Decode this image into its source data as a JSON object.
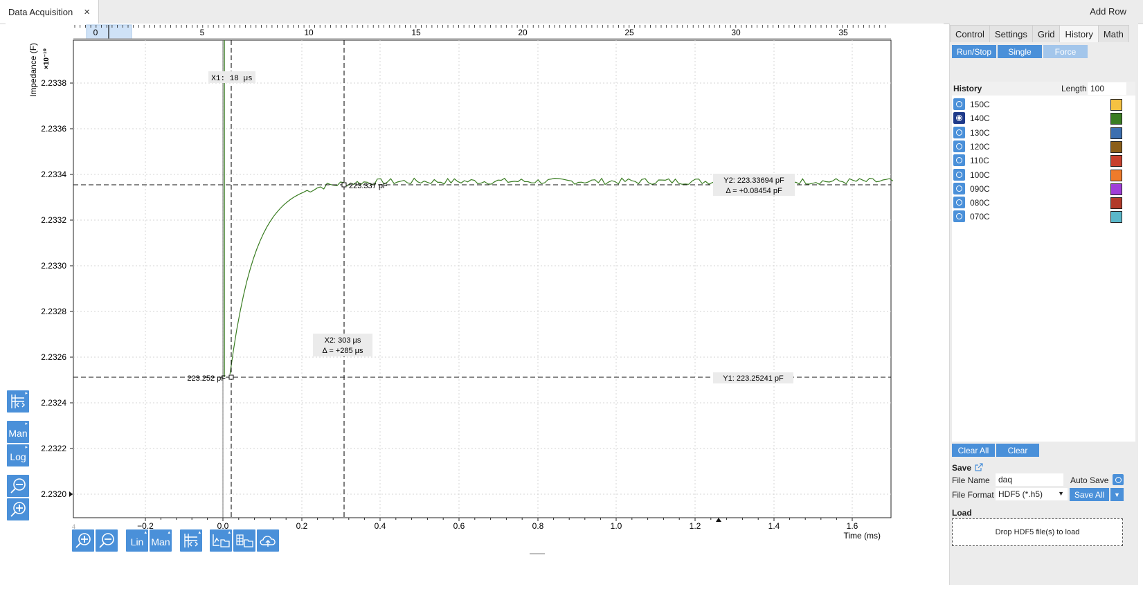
{
  "tab": {
    "title": "Data Acquisition",
    "close": "×"
  },
  "header": {
    "add_row": "Add Row"
  },
  "plot": {
    "y_axis_label": "Impedance (F)",
    "y_exponent": "×10⁻¹⁰",
    "x_axis_label": "Time (ms)",
    "y_ticks": [
      "2.2320",
      "2.2322",
      "2.2324",
      "2.2326",
      "2.2328",
      "2.2330",
      "2.2332",
      "2.2334",
      "2.2336",
      "2.2338"
    ],
    "x_ticks": [
      "−0.2",
      "0.0",
      "0.2",
      "0.4",
      "0.6",
      "0.8",
      "1.0",
      "1.2",
      "1.4",
      "1.6"
    ],
    "top_ticks": [
      "0",
      "5",
      "10",
      "15",
      "20",
      "25",
      "30",
      "35"
    ],
    "cursor_x1": {
      "label": "X1: 18 µs"
    },
    "cursor_x2": {
      "label": "X2: 303 µs",
      "delta": "Δ = +285 µs"
    },
    "cursor_y1": {
      "label": "Y1: 223.25241 pF"
    },
    "cursor_y2": {
      "label": "Y2: 223.33694 pF",
      "delta": "Δ = +0.08454 pF"
    },
    "point_low": "223.252 pF",
    "point_high": "223.337 pF",
    "trace_color": "#3a7d22"
  },
  "left_toolbar": {
    "man": "Man",
    "log": "Log"
  },
  "bottom_toolbar": {
    "lin": "Lin",
    "man": "Man"
  },
  "panel": {
    "tabs": [
      "Control",
      "Settings",
      "Grid",
      "History",
      "Math"
    ],
    "active_tab": "History",
    "buttons": {
      "run_stop": "Run/Stop",
      "single": "Single",
      "force": "Force"
    },
    "history": {
      "title": "History",
      "length_label": "Length",
      "length_value": "100",
      "items": [
        {
          "label": "150C",
          "color": "#f5c242",
          "selected": false
        },
        {
          "label": "140C",
          "color": "#3a7d22",
          "selected": true
        },
        {
          "label": "130C",
          "color": "#3c6fb0",
          "selected": false
        },
        {
          "label": "120C",
          "color": "#8b5e1a",
          "selected": false
        },
        {
          "label": "110C",
          "color": "#c7402d",
          "selected": false
        },
        {
          "label": "100C",
          "color": "#ef7b2b",
          "selected": false
        },
        {
          "label": "090C",
          "color": "#a03ed9",
          "selected": false
        },
        {
          "label": "080C",
          "color": "#b23a2a",
          "selected": false
        },
        {
          "label": "070C",
          "color": "#5ab7c9",
          "selected": false
        }
      ],
      "clear_all": "Clear All",
      "clear": "Clear"
    },
    "save": {
      "title": "Save",
      "file_name_label": "File Name",
      "file_name_value": "daq",
      "auto_save_label": "Auto Save",
      "file_format_label": "File Format",
      "file_format_value": "HDF5 (*.h5)",
      "save_all": "Save All"
    },
    "load": {
      "title": "Load",
      "drop_text": "Drop HDF5 file(s) to load"
    }
  }
}
